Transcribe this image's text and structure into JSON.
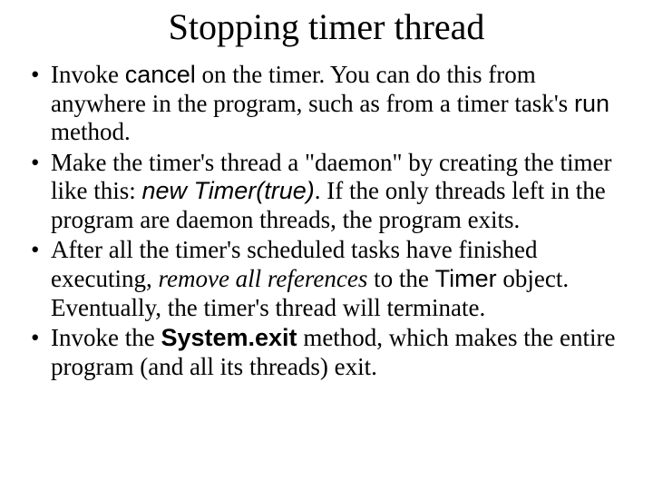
{
  "title": "Stopping timer thread",
  "b1": {
    "t1": "Invoke ",
    "t2": "cancel",
    "t3": " on the timer. You can do this from anywhere in the program, such as from a timer task's ",
    "t4": "run",
    "t5": " method."
  },
  "b2": {
    "t1": "Make the timer's thread a \"daemon\" by creating the timer like this: ",
    "t2": "new Timer(true)",
    "t3": ". If the only threads left in the program are daemon threads, the program exits."
  },
  "b3": {
    "t1": "After all the timer's scheduled tasks have finished executing, ",
    "t2": "remove all references",
    "t3": " to the ",
    "t4": "Timer",
    "t5": " object. Eventually, the timer's thread will terminate."
  },
  "b4": {
    "t1": "Invoke the ",
    "t2": "System.exit",
    "t3": " method, which makes the entire program (and all its threads) exit."
  }
}
